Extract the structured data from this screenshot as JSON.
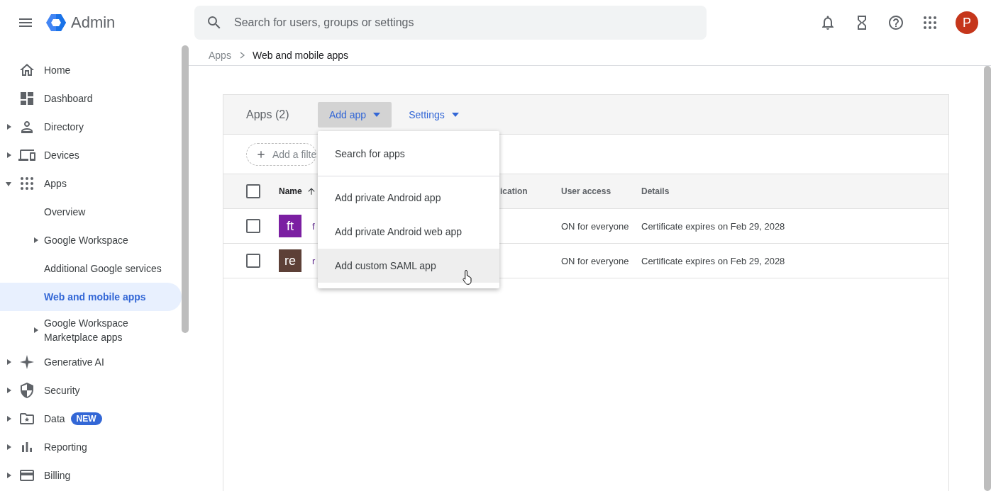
{
  "header": {
    "app_name": "Admin",
    "search": {
      "placeholder": "Search for users, groups or settings"
    },
    "avatar_initial": "P"
  },
  "sidebar": {
    "items": [
      {
        "label": "Home",
        "selected": false
      },
      {
        "label": "Dashboard",
        "selected": false
      },
      {
        "label": "Directory",
        "selected": false,
        "expanded": false
      },
      {
        "label": "Devices",
        "selected": false,
        "expanded": false
      },
      {
        "label": "Apps",
        "selected": false,
        "expanded": true,
        "children": [
          {
            "label": "Overview",
            "selected": false
          },
          {
            "label": "Google Workspace",
            "selected": false,
            "expanded": false
          },
          {
            "label": "Additional Google services",
            "selected": false
          },
          {
            "label": "Web and mobile apps",
            "selected": true
          },
          {
            "label": "Google Workspace Marketplace apps",
            "selected": false,
            "expanded": false
          }
        ]
      },
      {
        "label": "Generative AI",
        "selected": false,
        "expanded": false
      },
      {
        "label": "Security",
        "selected": false,
        "expanded": false
      },
      {
        "label": "Data",
        "selected": false,
        "expanded": false,
        "badge": "NEW"
      },
      {
        "label": "Reporting",
        "selected": false,
        "expanded": false
      },
      {
        "label": "Billing",
        "selected": false,
        "expanded": false
      }
    ]
  },
  "breadcrumb": [
    "Apps",
    "Web and mobile apps"
  ],
  "card": {
    "title": "Apps (2)",
    "actions": [
      {
        "label": "Add app",
        "expanded": true
      },
      {
        "label": "Settings",
        "expanded": false
      }
    ],
    "filter": {
      "label": "Add a filte"
    },
    "table": {
      "select_all": {
        "checked": false
      },
      "columns": [
        {
          "label": "Name",
          "sorted": true
        },
        {
          "label": "ication"
        },
        {
          "label": "User access"
        },
        {
          "label": "Details"
        }
      ],
      "rows": [
        {
          "checked": false,
          "avatar": "ft",
          "color": "#7b1fa2",
          "name": "f",
          "user_access": "ON for everyone",
          "details": "Certificate expires on Feb 29, 2028"
        },
        {
          "checked": false,
          "avatar": "re",
          "color": "#5d4037",
          "name": "r",
          "user_access": "ON for everyone",
          "details": "Certificate expires on Feb 29, 2028"
        }
      ]
    }
  },
  "menu": {
    "groups": [
      [
        {
          "label": "Search for apps",
          "hovered": false
        }
      ],
      [
        {
          "label": "Add private Android app",
          "hovered": false
        },
        {
          "label": "Add private Android web app",
          "hovered": false
        },
        {
          "label": "Add custom SAML app",
          "hovered": true
        }
      ]
    ]
  }
}
